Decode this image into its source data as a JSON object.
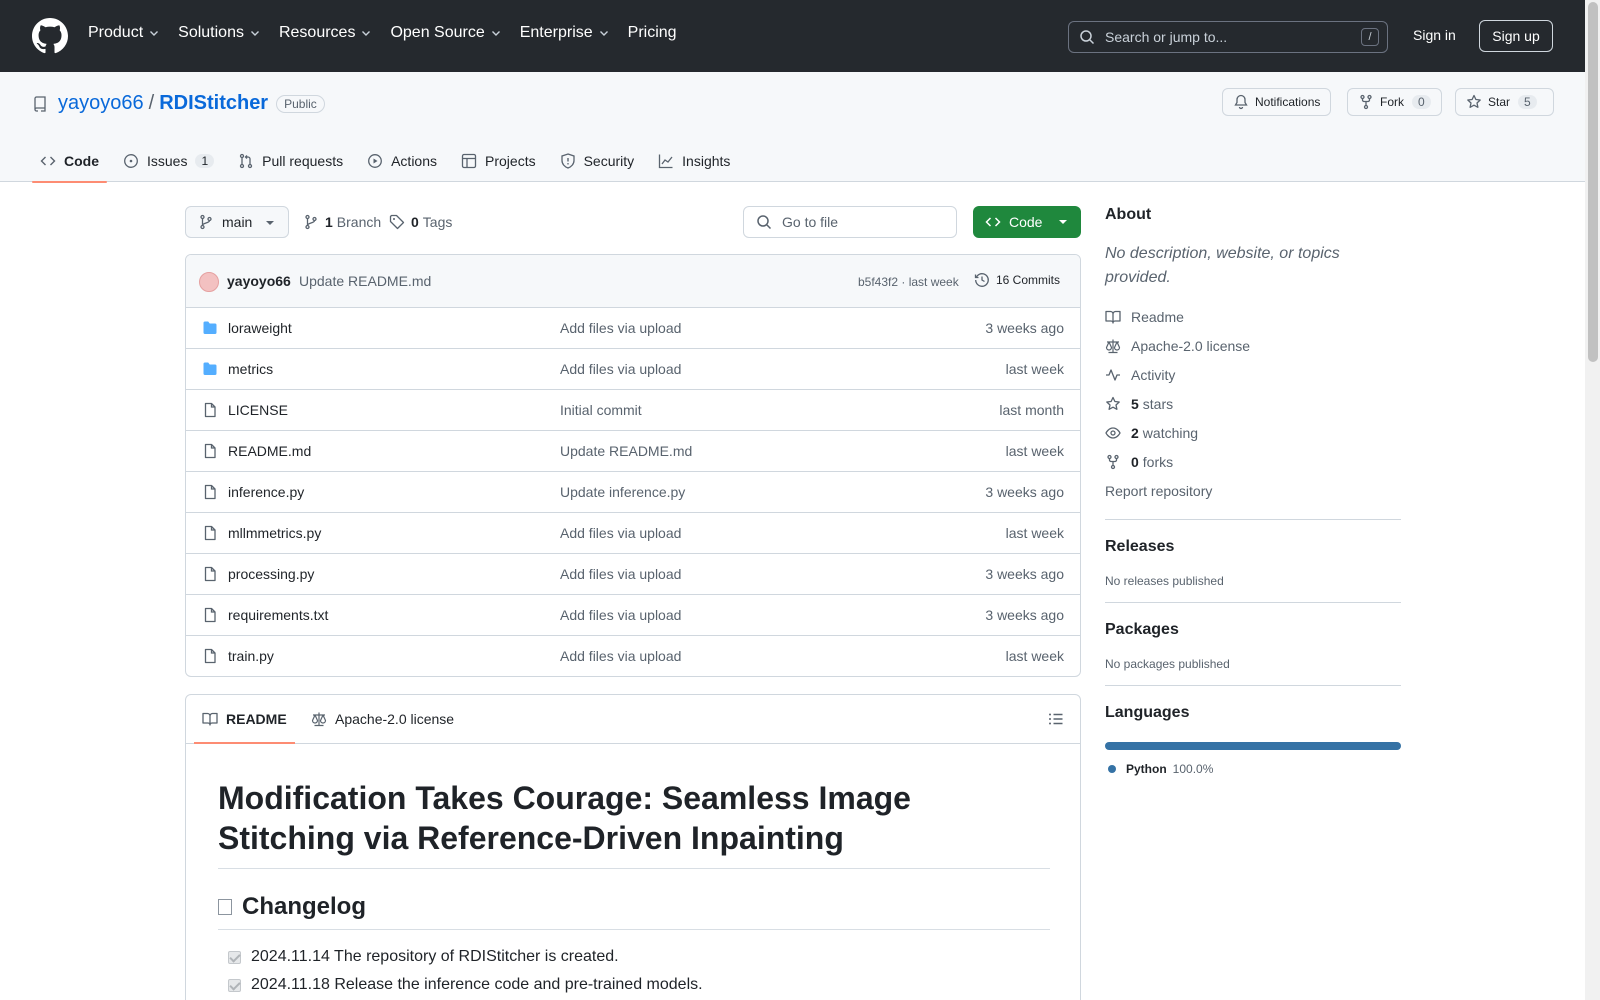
{
  "header": {
    "nav": [
      {
        "label": "Product",
        "dropdown": true
      },
      {
        "label": "Solutions",
        "dropdown": true
      },
      {
        "label": "Resources",
        "dropdown": true
      },
      {
        "label": "Open Source",
        "dropdown": true
      },
      {
        "label": "Enterprise",
        "dropdown": true
      },
      {
        "label": "Pricing",
        "dropdown": false
      }
    ],
    "search_placeholder": "Search or jump to...",
    "search_shortcut": "/",
    "sign_in": "Sign in",
    "sign_up": "Sign up"
  },
  "repo": {
    "owner": "yayoyo66",
    "separator": "/",
    "name": "RDIStitcher",
    "visibility": "Public",
    "notifications_label": "Notifications",
    "fork_label": "Fork",
    "fork_count": "0",
    "star_label": "Star",
    "star_count": "5"
  },
  "tabs": [
    {
      "label": "Code",
      "icon": "code-icon",
      "active": true,
      "count": ""
    },
    {
      "label": "Issues",
      "icon": "issue-icon",
      "active": false,
      "count": "1"
    },
    {
      "label": "Pull requests",
      "icon": "pull-request-icon",
      "active": false,
      "count": ""
    },
    {
      "label": "Actions",
      "icon": "play-icon",
      "active": false,
      "count": ""
    },
    {
      "label": "Projects",
      "icon": "table-icon",
      "active": false,
      "count": ""
    },
    {
      "label": "Security",
      "icon": "shield-icon",
      "active": false,
      "count": ""
    },
    {
      "label": "Insights",
      "icon": "graph-icon",
      "active": false,
      "count": ""
    }
  ],
  "toolbar": {
    "branch": "main",
    "branch_count": "1",
    "branch_label": "Branch",
    "tag_count": "0",
    "tag_label": "Tags",
    "goto_placeholder": "Go to file",
    "code_label": "Code"
  },
  "commit": {
    "author": "yayoyo66",
    "message": "Update README.md",
    "hash_time": "b5f43f2 · last week",
    "commits_label": "16 Commits"
  },
  "files": [
    {
      "name": "loraweight",
      "type": "dir",
      "message": "Add files via upload",
      "age": "3 weeks ago"
    },
    {
      "name": "metrics",
      "type": "dir",
      "message": "Add files via upload",
      "age": "last week"
    },
    {
      "name": "LICENSE",
      "type": "file",
      "message": "Initial commit",
      "age": "last month"
    },
    {
      "name": "README.md",
      "type": "file",
      "message": "Update README.md",
      "age": "last week"
    },
    {
      "name": "inference.py",
      "type": "file",
      "message": "Update inference.py",
      "age": "3 weeks ago"
    },
    {
      "name": "mllmmetrics.py",
      "type": "file",
      "message": "Add files via upload",
      "age": "last week"
    },
    {
      "name": "processing.py",
      "type": "file",
      "message": "Add files via upload",
      "age": "3 weeks ago"
    },
    {
      "name": "requirements.txt",
      "type": "file",
      "message": "Add files via upload",
      "age": "3 weeks ago"
    },
    {
      "name": "train.py",
      "type": "file",
      "message": "Add files via upload",
      "age": "last week"
    }
  ],
  "readme": {
    "tab_readme": "README",
    "tab_license": "Apache-2.0 license",
    "title": "Modification Takes Courage: Seamless Image Stitching via Reference-Driven Inpainting",
    "changelog_heading": "Changelog",
    "tasks": [
      "2024.11.14 The repository of RDIStitcher is created.",
      "2024.11.18 Release the inference code and pre-trained models."
    ]
  },
  "about": {
    "heading": "About",
    "description": "No description, website, or topics provided.",
    "links": [
      {
        "icon": "book-icon",
        "count": "",
        "label": "Readme"
      },
      {
        "icon": "law-icon",
        "count": "",
        "label": "Apache-2.0 license"
      },
      {
        "icon": "pulse-icon",
        "count": "",
        "label": "Activity"
      },
      {
        "icon": "star-icon",
        "count": "5",
        "label": "stars"
      },
      {
        "icon": "eye-icon",
        "count": "2",
        "label": "watching"
      },
      {
        "icon": "fork-icon",
        "count": "0",
        "label": "forks"
      }
    ],
    "report": "Report repository",
    "releases_heading": "Releases",
    "releases_text": "No releases published",
    "packages_heading": "Packages",
    "packages_text": "No packages published",
    "languages_heading": "Languages",
    "language_name": "Python",
    "language_percent": "100.0%",
    "language_color": "#3572a5"
  },
  "colors": {
    "header_bg": "#25292e",
    "link": "#0969da",
    "code_button": "#1f883d",
    "active_tab_underline": "#fd8c73"
  }
}
